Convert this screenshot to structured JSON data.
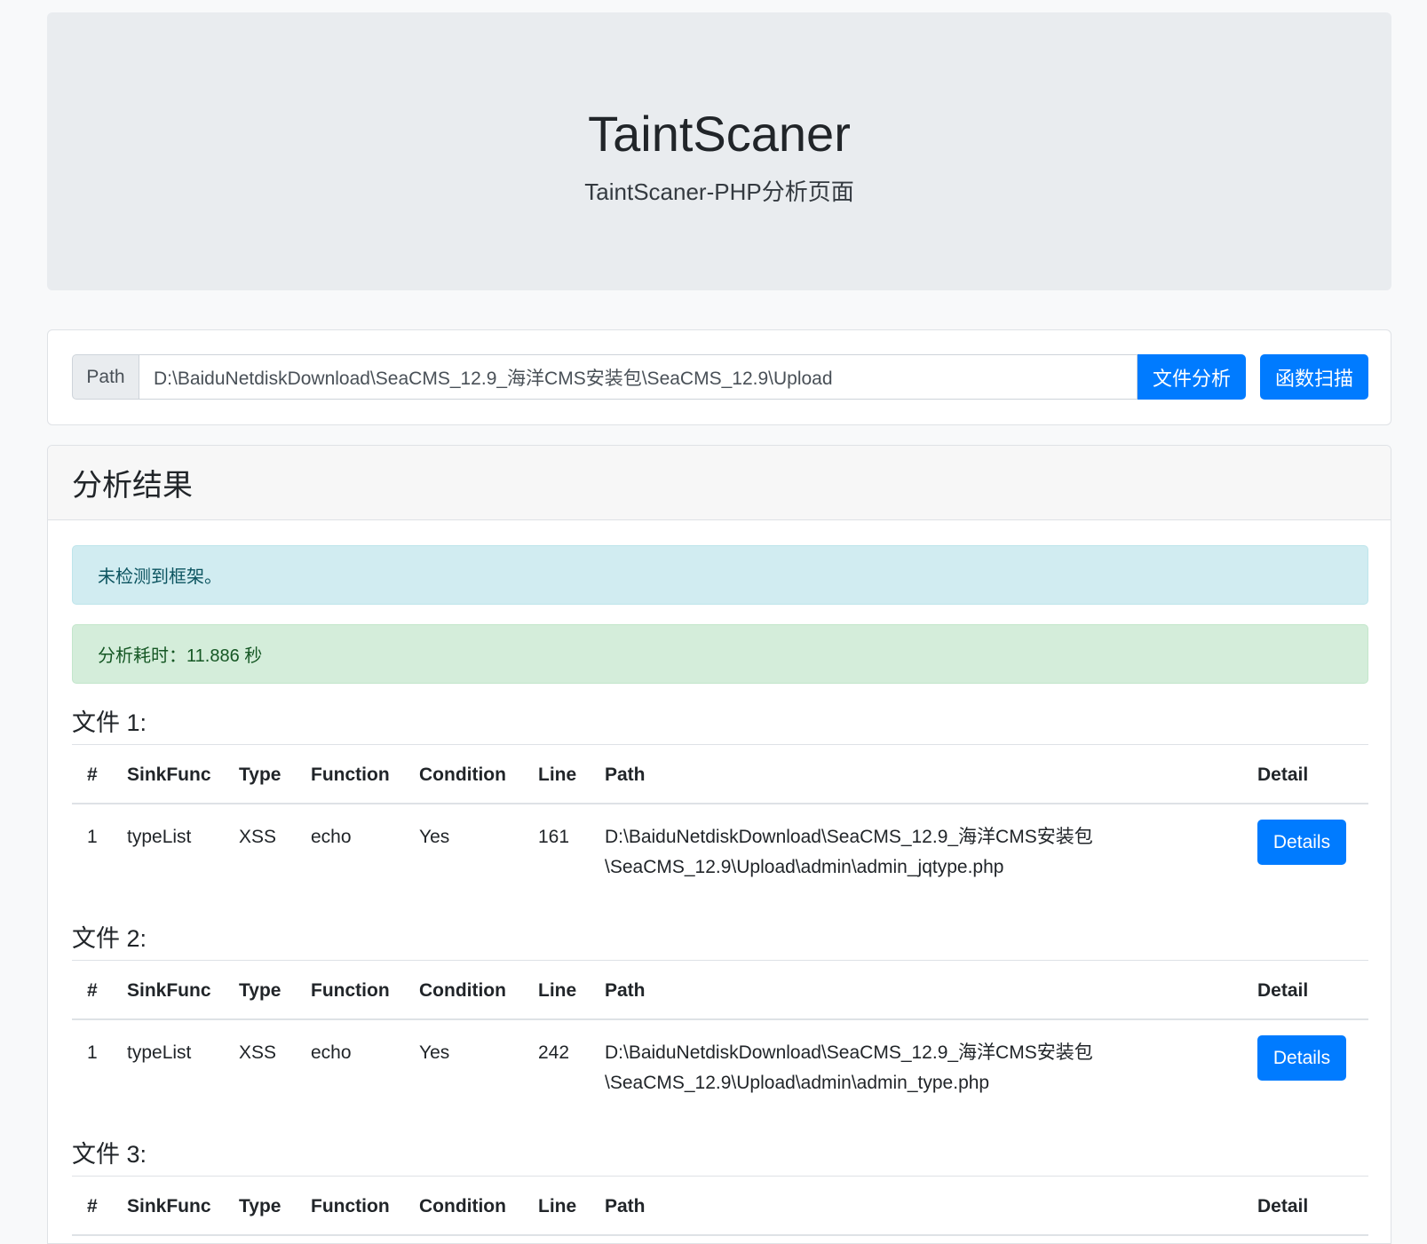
{
  "header": {
    "title": "TaintScaner",
    "subtitle": "TaintScaner-PHP分析页面"
  },
  "search": {
    "addon_label": "Path",
    "path_value": "D:\\BaiduNetdiskDownload\\SeaCMS_12.9_海洋CMS安装包\\SeaCMS_12.9\\Upload",
    "file_analysis_label": "文件分析",
    "function_scan_label": "函数扫描"
  },
  "results": {
    "title": "分析结果",
    "framework_alert": "未检测到框架。",
    "time_alert": "分析耗时：11.886 秒",
    "columns": [
      "#",
      "SinkFunc",
      "Type",
      "Function",
      "Condition",
      "Line",
      "Path",
      "Detail"
    ],
    "files": [
      {
        "title": "文件 1:",
        "rows": [
          {
            "num": "1",
            "sink": "typeList",
            "type": "XSS",
            "func": "echo",
            "cond": "Yes",
            "line": "161",
            "path1": "D:\\BaiduNetdiskDownload\\SeaCMS_12.9_海洋CMS安装包",
            "path2": "\\SeaCMS_12.9\\Upload\\admin\\admin_jqtype.php",
            "detail": "Details"
          }
        ]
      },
      {
        "title": "文件 2:",
        "rows": [
          {
            "num": "1",
            "sink": "typeList",
            "type": "XSS",
            "func": "echo",
            "cond": "Yes",
            "line": "242",
            "path1": "D:\\BaiduNetdiskDownload\\SeaCMS_12.9_海洋CMS安装包",
            "path2": "\\SeaCMS_12.9\\Upload\\admin\\admin_type.php",
            "detail": "Details"
          }
        ]
      },
      {
        "title": "文件 3:",
        "rows": []
      }
    ]
  },
  "colors": {
    "primary": "#007bff",
    "info_bg": "#d1ecf1",
    "success_bg": "#d4edda"
  }
}
